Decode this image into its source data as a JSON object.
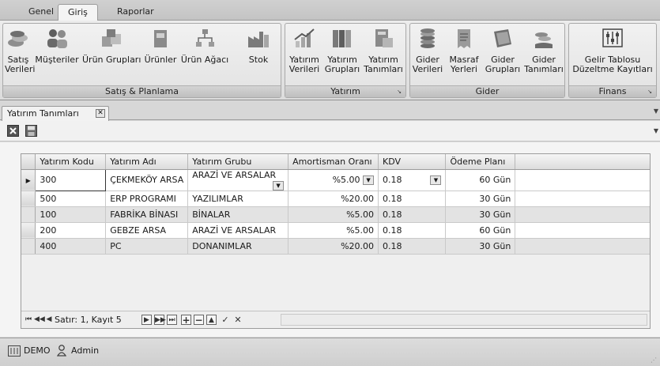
{
  "ribbon_tabs": [
    "Genel",
    "Giriş",
    "Raporlar"
  ],
  "ribbon_groups": {
    "sales": {
      "caption": "Satış & Planlama",
      "buttons": [
        {
          "label1": "Satış",
          "label2": "Verileri",
          "icon": "coins-icon"
        },
        {
          "label1": "Müşteriler",
          "label2": "",
          "icon": "people-icon"
        },
        {
          "label1": "Ürün Grupları",
          "label2": "",
          "icon": "boxes-icon"
        },
        {
          "label1": "Ürünler",
          "label2": "",
          "icon": "product-box-icon"
        },
        {
          "label1": "Ürün Ağacı",
          "label2": "",
          "icon": "tree-icon"
        },
        {
          "label1": "Stok",
          "label2": "",
          "icon": "factory-icon"
        }
      ]
    },
    "investment": {
      "caption": "Yatırım",
      "buttons": [
        {
          "label1": "Yatırım",
          "label2": "Verileri",
          "icon": "growth-chart-icon"
        },
        {
          "label1": "Yatırım",
          "label2": "Grupları",
          "icon": "binders-icon"
        },
        {
          "label1": "Yatırım",
          "label2": "Tanımları",
          "icon": "calculator-icon"
        }
      ]
    },
    "expense": {
      "caption": "Gider",
      "buttons": [
        {
          "label1": "Gider",
          "label2": "Verileri",
          "icon": "coin-stack-icon"
        },
        {
          "label1": "Masraf",
          "label2": "Yerleri",
          "icon": "receipt-icon"
        },
        {
          "label1": "Gider",
          "label2": "Grupları",
          "icon": "banknotes-icon"
        },
        {
          "label1": "Gider",
          "label2": "Tanımları",
          "icon": "money-hand-icon"
        }
      ]
    },
    "finance": {
      "caption": "Finans",
      "buttons": [
        {
          "label1": "Gelir Tablosu",
          "label2": "Düzeltme Kayıtları",
          "icon": "sliders-icon"
        }
      ]
    }
  },
  "document_tab": {
    "label": "Yatırım Tanımları",
    "close_glyph": "✕"
  },
  "grid": {
    "columns": [
      "Yatırım Kodu",
      "Yatırım Adı",
      "Yatırım Grubu",
      "Amortisman Oranı",
      "KDV",
      "Ödeme Planı"
    ],
    "rows": [
      {
        "code": "300",
        "name": "ÇEKMEKÖY ARSA",
        "group": "ARAZİ VE ARSALAR",
        "rate": "%5.00",
        "kdv": "0.18",
        "plan": "60 Gün"
      },
      {
        "code": "500",
        "name": "ERP PROGRAMI",
        "group": "YAZILIMLAR",
        "rate": "%20.00",
        "kdv": "0.18",
        "plan": "30 Gün"
      },
      {
        "code": "100",
        "name": "FABRİKA BİNASI",
        "group": "BİNALAR",
        "rate": "%5.00",
        "kdv": "0.18",
        "plan": "30 Gün"
      },
      {
        "code": "200",
        "name": "GEBZE ARSA",
        "group": "ARAZİ VE ARSALAR",
        "rate": "%5.00",
        "kdv": "0.18",
        "plan": "60 Gün"
      },
      {
        "code": "400",
        "name": "PC",
        "group": "DONANIMLAR",
        "rate": "%20.00",
        "kdv": "0.18",
        "plan": "30 Gün"
      }
    ]
  },
  "navigator": {
    "status": "Satır: 1, Kayıt 5",
    "first": "⏮",
    "prev_page": "◀◀",
    "prev": "◀",
    "next": "▶",
    "next_page": "▶▶",
    "last": "⏭",
    "add": "+",
    "delete": "−",
    "edit": "▲",
    "post": "✓",
    "cancel": "✕"
  },
  "status_bar": {
    "company": "DEMO",
    "user": "Admin"
  }
}
